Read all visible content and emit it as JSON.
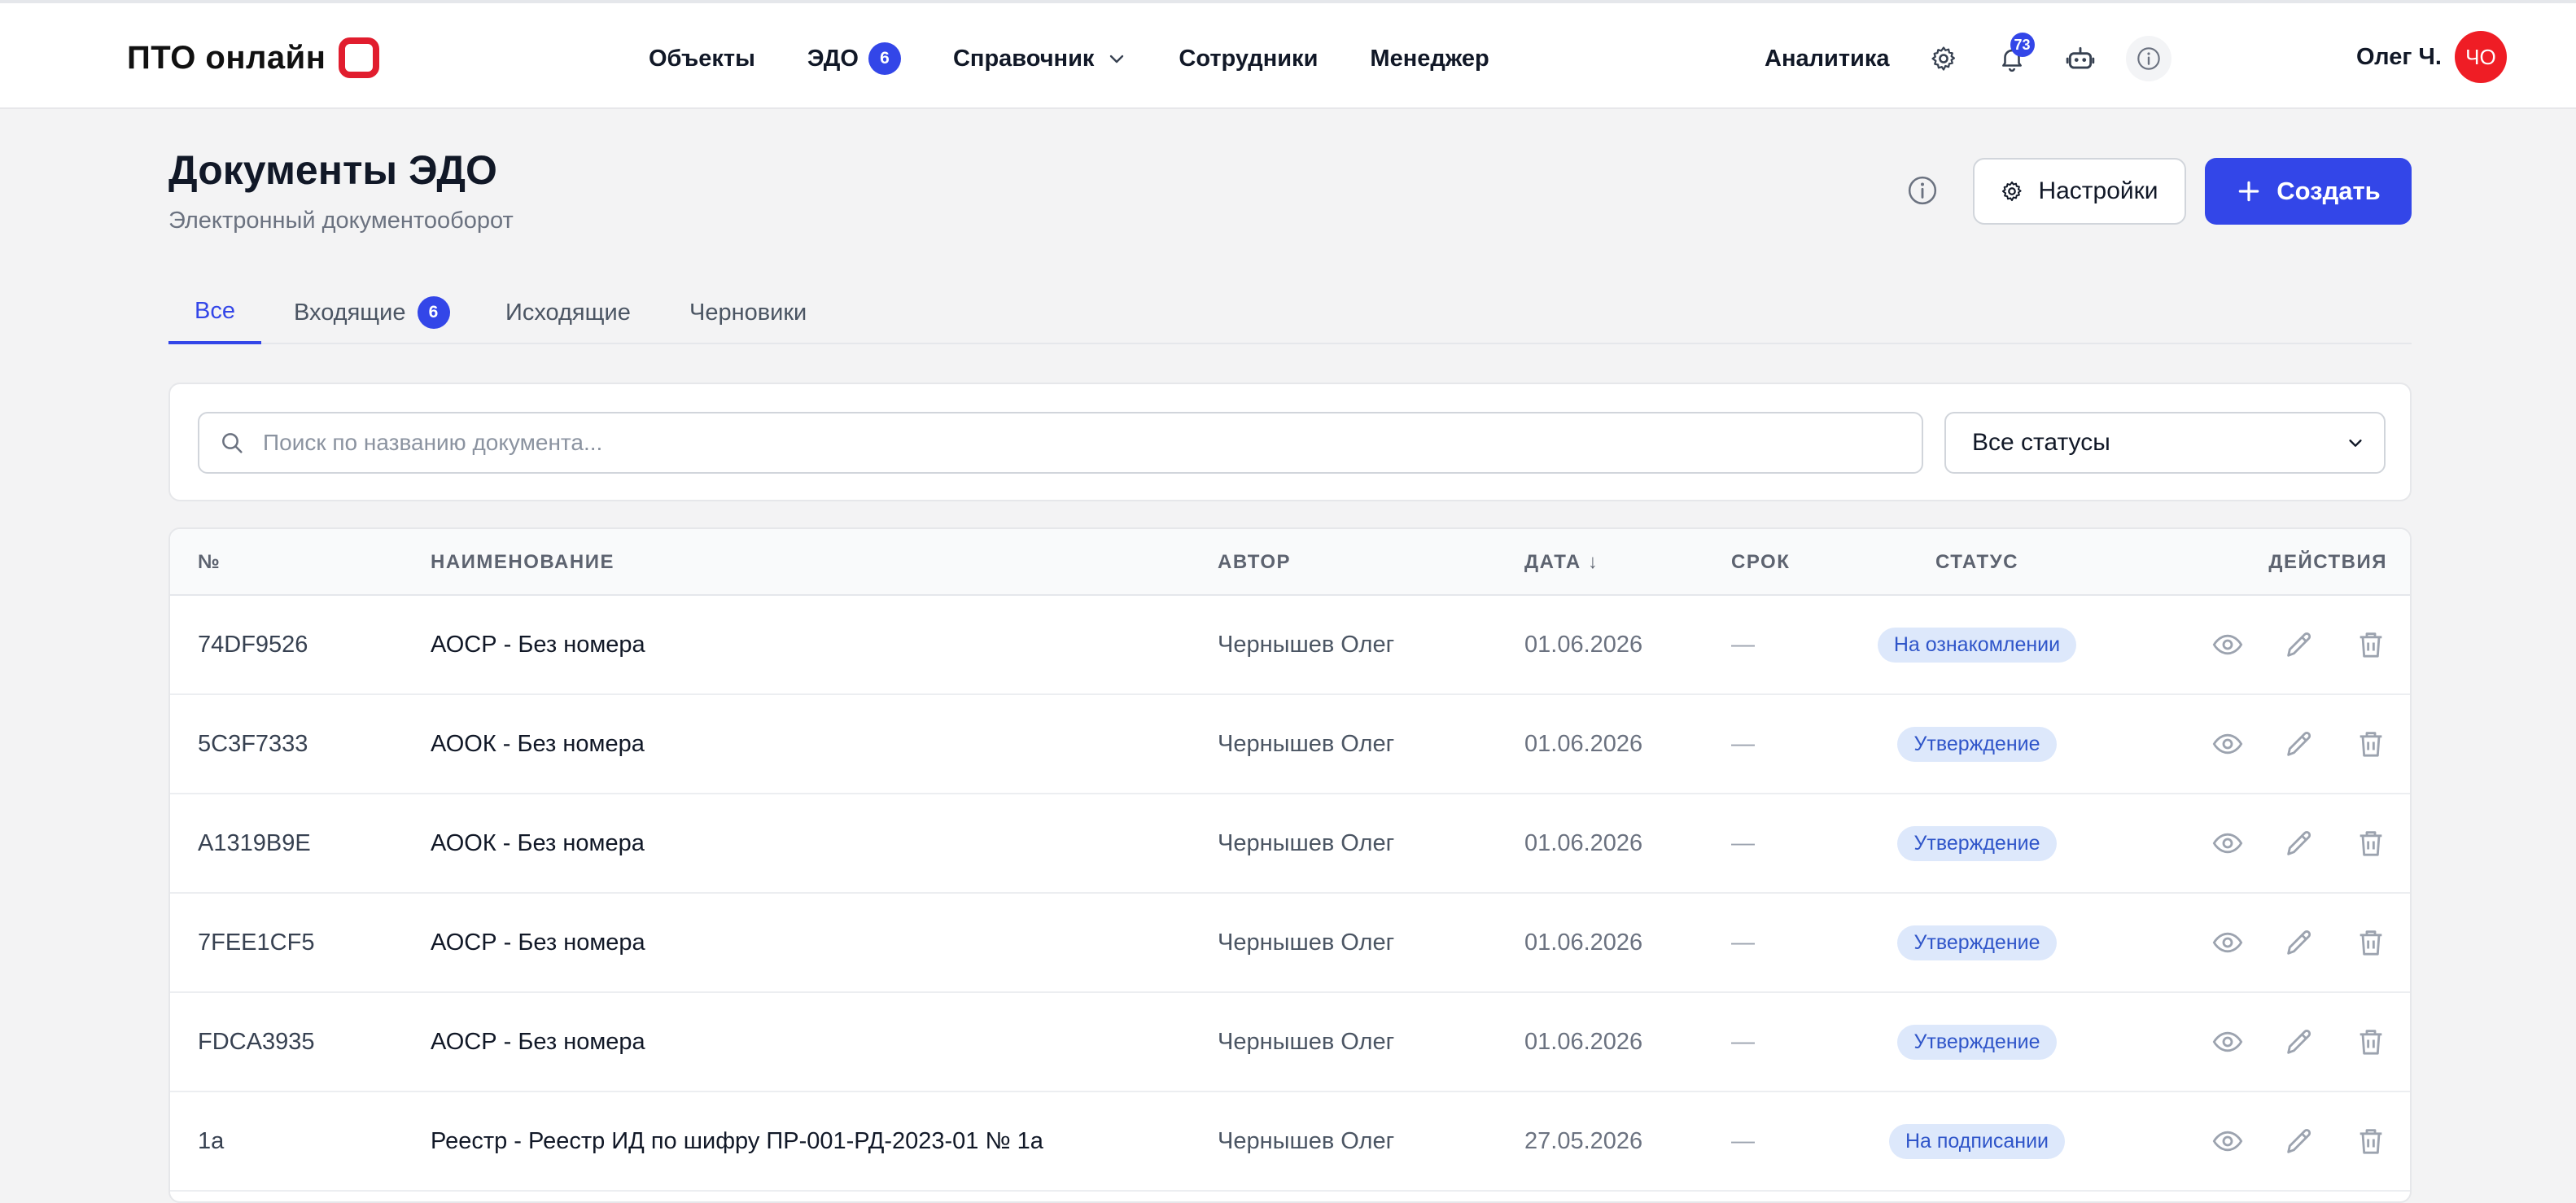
{
  "header": {
    "logo_text": "ПТО онлайн",
    "nav": {
      "objects": "Объекты",
      "edo": "ЭДО",
      "edo_badge": "6",
      "reference": "Справочник",
      "employees": "Сотрудники",
      "manager": "Менеджер"
    },
    "analytics": "Аналитика",
    "notifications_count": "73",
    "user_name": "Олег Ч.",
    "avatar_initials": "ЧО"
  },
  "page": {
    "title": "Документы ЭДО",
    "subtitle": "Электронный документооборот",
    "settings_label": "Настройки",
    "create_label": "Создать"
  },
  "tabs": [
    {
      "label": "Все"
    },
    {
      "label": "Входящие",
      "badge": "6"
    },
    {
      "label": "Исходящие"
    },
    {
      "label": "Черновики"
    }
  ],
  "filters": {
    "search_placeholder": "Поиск по названию документа...",
    "status_value": "Все статусы"
  },
  "table": {
    "columns": {
      "num": "№",
      "name": "НАИМЕНОВАНИЕ",
      "author": "АВТОР",
      "date": "ДАТА ↓",
      "due": "СРОК",
      "status": "СТАТУС",
      "actions": "ДЕЙСТВИЯ"
    },
    "rows": [
      {
        "num": "74DF9526",
        "name": "АОСР - Без номера",
        "author": "Чернышев Олег",
        "date": "01.06.2026",
        "due": "—",
        "status": "На ознакомлении"
      },
      {
        "num": "5C3F7333",
        "name": "АООК - Без номера",
        "author": "Чернышев Олег",
        "date": "01.06.2026",
        "due": "—",
        "status": "Утверждение"
      },
      {
        "num": "A1319B9E",
        "name": "АООК - Без номера",
        "author": "Чернышев Олег",
        "date": "01.06.2026",
        "due": "—",
        "status": "Утверждение"
      },
      {
        "num": "7FEE1CF5",
        "name": "АОСР - Без номера",
        "author": "Чернышев Олег",
        "date": "01.06.2026",
        "due": "—",
        "status": "Утверждение"
      },
      {
        "num": "FDCA3935",
        "name": "АОСР - Без номера",
        "author": "Чернышев Олег",
        "date": "01.06.2026",
        "due": "—",
        "status": "Утверждение"
      },
      {
        "num": "1а",
        "name": "Реестр - Реестр ИД по шифру ПР-001-РД-2023-01 № 1а",
        "author": "Чернышев Олег",
        "date": "27.05.2026",
        "due": "—",
        "status": "На подписании"
      }
    ]
  },
  "colors": {
    "accent": "#3346e8",
    "brand_red": "#e11d2e",
    "status_bg": "#dde8fb",
    "status_text": "#2f55c9"
  },
  "icons": [
    "search-icon",
    "gear-icon",
    "bell-icon",
    "robot-icon",
    "info-icon",
    "chevron-down-icon",
    "plus-icon",
    "eye-icon",
    "pencil-icon",
    "trash-icon"
  ]
}
